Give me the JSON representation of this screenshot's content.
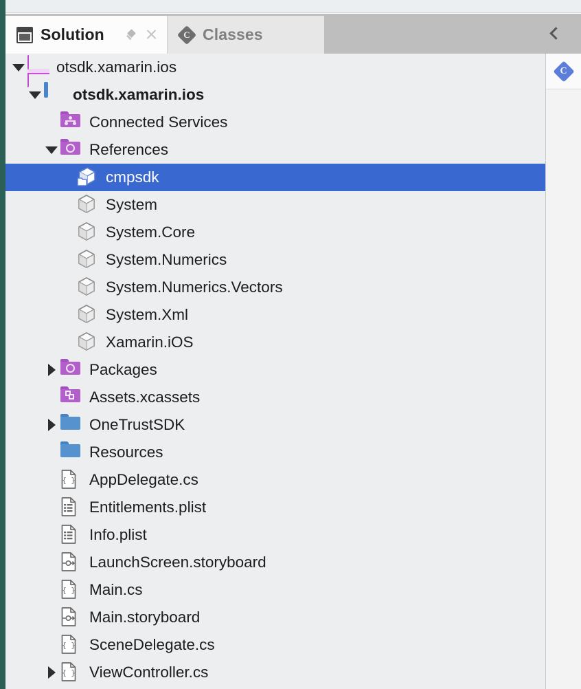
{
  "window": {
    "accent_strip_color": "#2C6057",
    "header_band_color": "#BEBEBE",
    "pane_background": "#ECEEF0",
    "selection_color": "#3A68D1"
  },
  "tabs": [
    {
      "label": "Solution",
      "icon": "solution-panel-icon",
      "active": true
    },
    {
      "label": "Classes",
      "icon": "classes-panel-icon",
      "active": false
    }
  ],
  "tab_actions": {
    "pin_label": "Pin",
    "pin_icon": "pin-icon",
    "close_label": "Close",
    "close_icon": "close-icon"
  },
  "header": {
    "collapse_icon": "chevron-left-icon",
    "collapse_label": "Collapse panel"
  },
  "right_rail": {
    "buttons": [
      {
        "label": "Classes",
        "icon": "classes-diamond-icon"
      }
    ]
  },
  "tree": {
    "rows": [
      {
        "label": "otsdk.xamarin.ios",
        "icon": "solution-icon",
        "indent": 0,
        "twisty": "open",
        "bold": false,
        "selected": false
      },
      {
        "label": "otsdk.xamarin.ios",
        "icon": "project-icon",
        "indent": 1,
        "twisty": "open",
        "bold": true,
        "selected": false
      },
      {
        "label": "Connected Services",
        "icon": "connected-services-icon",
        "indent": 2,
        "twisty": "none",
        "bold": false,
        "selected": false
      },
      {
        "label": "References",
        "icon": "references-folder-icon",
        "indent": 2,
        "twisty": "open",
        "bold": false,
        "selected": false
      },
      {
        "label": "cmpsdk",
        "icon": "package-assembly-icon",
        "indent": 3,
        "twisty": "none",
        "bold": false,
        "selected": true
      },
      {
        "label": "System",
        "icon": "assembly-icon",
        "indent": 3,
        "twisty": "none",
        "bold": false,
        "selected": false
      },
      {
        "label": "System.Core",
        "icon": "assembly-icon",
        "indent": 3,
        "twisty": "none",
        "bold": false,
        "selected": false
      },
      {
        "label": "System.Numerics",
        "icon": "assembly-icon",
        "indent": 3,
        "twisty": "none",
        "bold": false,
        "selected": false
      },
      {
        "label": "System.Numerics.Vectors",
        "icon": "assembly-icon",
        "indent": 3,
        "twisty": "none",
        "bold": false,
        "selected": false
      },
      {
        "label": "System.Xml",
        "icon": "assembly-icon",
        "indent": 3,
        "twisty": "none",
        "bold": false,
        "selected": false
      },
      {
        "label": "Xamarin.iOS",
        "icon": "assembly-icon",
        "indent": 3,
        "twisty": "none",
        "bold": false,
        "selected": false
      },
      {
        "label": "Packages",
        "icon": "packages-folder-icon",
        "indent": 2,
        "twisty": "closed",
        "bold": false,
        "selected": false
      },
      {
        "label": "Assets.xcassets",
        "icon": "assets-folder-icon",
        "indent": 2,
        "twisty": "none",
        "bold": false,
        "selected": false
      },
      {
        "label": "OneTrustSDK",
        "icon": "blue-folder-icon",
        "indent": 2,
        "twisty": "closed",
        "bold": false,
        "selected": false
      },
      {
        "label": "Resources",
        "icon": "blue-folder-icon",
        "indent": 2,
        "twisty": "none",
        "bold": false,
        "selected": false
      },
      {
        "label": "AppDelegate.cs",
        "icon": "csharp-file-icon",
        "indent": 2,
        "twisty": "none",
        "bold": false,
        "selected": false
      },
      {
        "label": "Entitlements.plist",
        "icon": "plist-file-icon",
        "indent": 2,
        "twisty": "none",
        "bold": false,
        "selected": false
      },
      {
        "label": "Info.plist",
        "icon": "plist-file-icon",
        "indent": 2,
        "twisty": "none",
        "bold": false,
        "selected": false
      },
      {
        "label": "LaunchScreen.storyboard",
        "icon": "storyboard-file-icon",
        "indent": 2,
        "twisty": "none",
        "bold": false,
        "selected": false
      },
      {
        "label": "Main.cs",
        "icon": "csharp-file-icon",
        "indent": 2,
        "twisty": "none",
        "bold": false,
        "selected": false
      },
      {
        "label": "Main.storyboard",
        "icon": "storyboard-file-icon",
        "indent": 2,
        "twisty": "none",
        "bold": false,
        "selected": false
      },
      {
        "label": "SceneDelegate.cs",
        "icon": "csharp-file-icon",
        "indent": 2,
        "twisty": "none",
        "bold": false,
        "selected": false
      },
      {
        "label": "ViewController.cs",
        "icon": "csharp-file-icon",
        "indent": 2,
        "twisty": "closed",
        "bold": false,
        "selected": false
      }
    ]
  }
}
